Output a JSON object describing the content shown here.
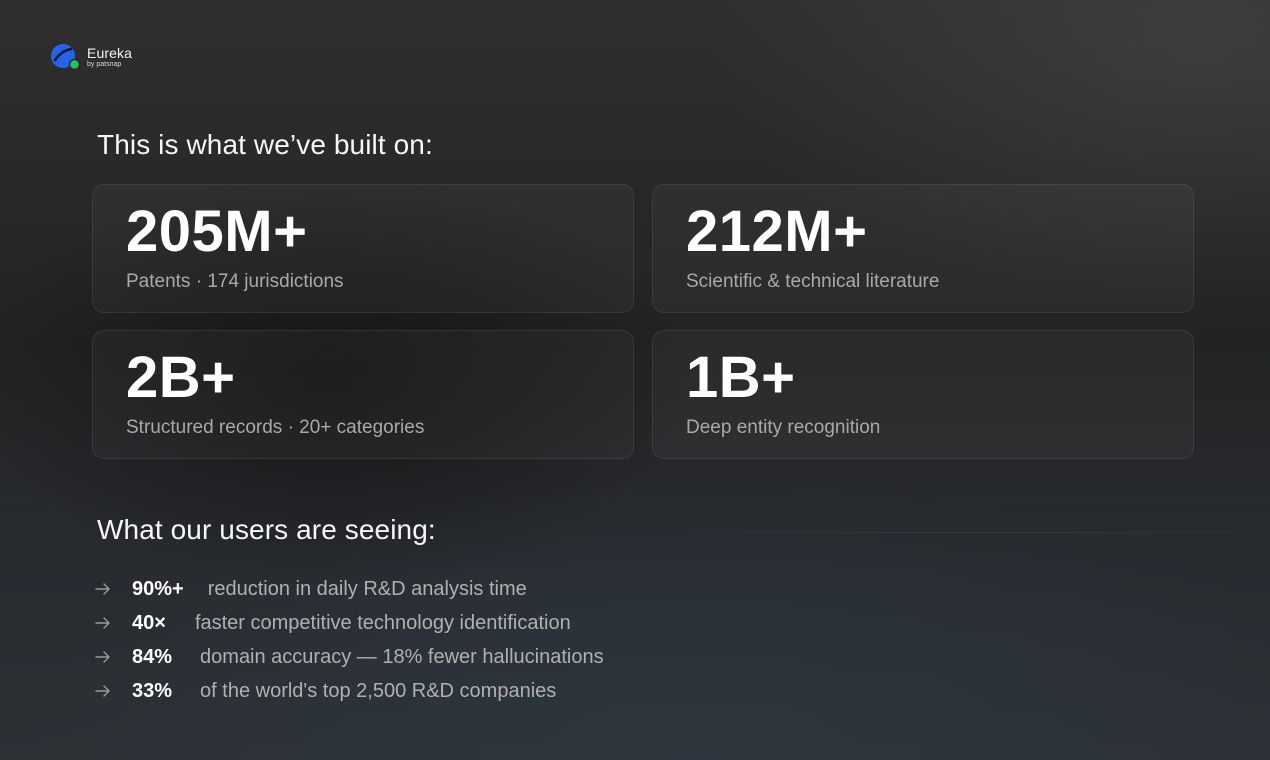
{
  "brand": {
    "name": "Eureka",
    "sub": "by patsnap",
    "colors": {
      "primary": "#2563eb",
      "accent": "#22c55e"
    }
  },
  "section1": {
    "title": "This is what we’ve built on:",
    "cards": [
      {
        "value": "205M+",
        "label": "Patents · 174 jurisdictions"
      },
      {
        "value": "212M+",
        "label": "Scientific & technical literature"
      },
      {
        "value": "2B+",
        "label": "Structured records · 20+ categories"
      },
      {
        "value": "1B+",
        "label": "Deep entity recognition"
      }
    ]
  },
  "section2": {
    "title": "What our users are seeing:",
    "items": [
      {
        "icon": "arrow-right-icon",
        "stat": "90%+",
        "text": "reduction in daily R&D analysis time"
      },
      {
        "icon": "arrow-right-icon",
        "stat": "40×",
        "text": "faster competitive technology identification"
      },
      {
        "icon": "arrow-right-icon",
        "stat": "84%",
        "text": "domain accuracy — 18% fewer hallucinations"
      },
      {
        "icon": "arrow-right-icon",
        "stat": "33%",
        "text": "of the world's top 2,500 R&D companies"
      }
    ]
  }
}
